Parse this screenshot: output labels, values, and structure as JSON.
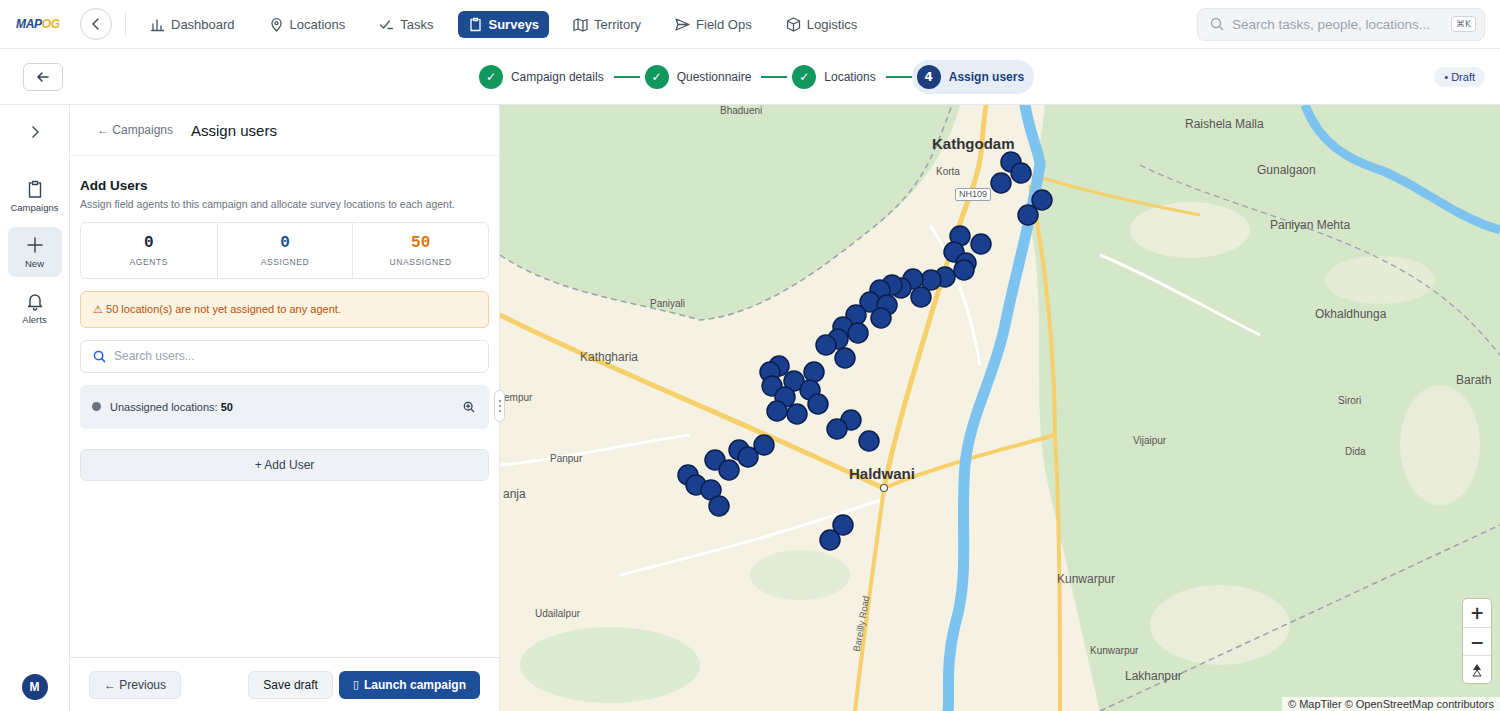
{
  "logo": [
    {
      "text": "MAP",
      "color": "#1d4b8f"
    },
    {
      "text": "OG",
      "color": "#f0b429"
    }
  ],
  "nav": {
    "items": [
      {
        "label": "Dashboard",
        "selected": false
      },
      {
        "label": "Locations",
        "selected": false
      },
      {
        "label": "Tasks",
        "selected": false
      },
      {
        "label": "Surveys",
        "selected": true
      },
      {
        "label": "Territory",
        "selected": false
      },
      {
        "label": "Field Ops",
        "selected": false
      },
      {
        "label": "Logistics",
        "selected": false
      }
    ]
  },
  "search": {
    "placeholder": "Search tasks, people, locations...",
    "shortcut": "⌘K"
  },
  "stepper": {
    "steps": [
      {
        "mark": "✓",
        "label": "Campaign details",
        "done": true,
        "selected": false
      },
      {
        "mark": "✓",
        "label": "Questionnaire",
        "done": true,
        "selected": false
      },
      {
        "mark": "✓",
        "label": "Locations",
        "done": true,
        "selected": false
      },
      {
        "mark": "4",
        "label": "Assign users",
        "done": false,
        "selected": true
      }
    ],
    "status": "• Draft"
  },
  "rail": {
    "items": [
      {
        "label": "Campaigns",
        "selected": false
      },
      {
        "label": "New",
        "selected": true
      },
      {
        "label": "Alerts",
        "selected": false
      }
    ],
    "avatar": "M"
  },
  "panel": {
    "back_link": "← Campaigns",
    "title": "Assign users",
    "section_title": "Add Users",
    "description": "Assign field agents to this campaign and allocate survey locations to each agent.",
    "stats": [
      {
        "value": "0",
        "label": "AGENTS",
        "color": "#1f2937"
      },
      {
        "value": "0",
        "label": "ASSIGNED",
        "color": "#1e4e8c"
      },
      {
        "value": "50",
        "label": "UNASSIGNED",
        "color": "#d97706"
      }
    ],
    "warning": "⚠ 50 location(s) are not yet assigned to any agent.",
    "user_search": {
      "placeholder": "Search users..."
    },
    "unassigned": {
      "label": "Unassigned locations:",
      "count": "50"
    },
    "add_button": "+ Add User"
  },
  "footer": {
    "previous": "← Previous",
    "save": "Save draft",
    "launch": {
      "icon": "▯",
      "label": "Launch campaign"
    }
  },
  "map": {
    "labels": [
      {
        "text": "Bhadueni",
        "kind": "hamlet"
      },
      {
        "text": "Kathgodam",
        "kind": "town"
      },
      {
        "text": "Korta",
        "kind": "hamlet"
      },
      {
        "text": "NH109",
        "kind": "shield"
      },
      {
        "text": "Raishela Malla",
        "kind": "place"
      },
      {
        "text": "Gunalgaon",
        "kind": "place"
      },
      {
        "text": "Paniyan Mehta",
        "kind": "place"
      },
      {
        "text": "Okhaldhunga",
        "kind": "place"
      },
      {
        "text": "Barath",
        "kind": "place"
      },
      {
        "text": "Paniyali",
        "kind": "hamlet"
      },
      {
        "text": "Kathgharia",
        "kind": "place"
      },
      {
        "text": "empur",
        "kind": "hamlet"
      },
      {
        "text": "Panpur",
        "kind": "hamlet"
      },
      {
        "text": "anja",
        "kind": "place"
      },
      {
        "text": "Haldwani",
        "kind": "town"
      },
      {
        "text": "Vijaipur",
        "kind": "hamlet"
      },
      {
        "text": "Sirori",
        "kind": "hamlet"
      },
      {
        "text": "Dida",
        "kind": "hamlet"
      },
      {
        "text": "Kunwarpur",
        "kind": "place"
      },
      {
        "text": "Kunwarpur",
        "kind": "hamlet"
      },
      {
        "text": "Udailalpur",
        "kind": "hamlet"
      },
      {
        "text": "Bareilly Road",
        "kind": "street"
      },
      {
        "text": "Lakhanpur",
        "kind": "place"
      }
    ],
    "zoom_in": "+",
    "zoom_out": "−",
    "attribution": "© MapTiler © OpenStreetMap contributors"
  }
}
